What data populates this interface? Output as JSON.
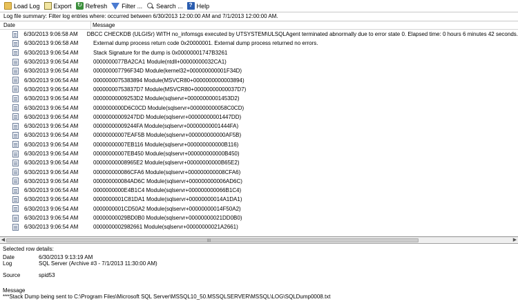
{
  "toolbar": {
    "load_log": "Load Log",
    "export": "Export",
    "refresh": "Refresh",
    "filter": "Filter ...",
    "search": "Search ...",
    "help": "Help"
  },
  "summary": "Log file summary: Filter log entries where: occurred between 6/30/2013 12:00:00 AM and 7/1/2013 12:00:00 AM.",
  "columns": {
    "date": "Date",
    "message": "Message"
  },
  "rows": [
    {
      "date": "6/30/2013 9:06:58 AM",
      "message": "DBCC CHECKDB (ULGISr) WITH no_infomsgs executed by UTSYSTEM\\ULSQLAgent terminated abnormally due to error state 0. Elapsed time: 0 hours 6 minutes 42 seconds."
    },
    {
      "date": "6/30/2013 9:06:58 AM",
      "message": "External dump process return code 0x20000001.  External dump process returned no errors."
    },
    {
      "date": "6/30/2013 9:06:54 AM",
      "message": "Stack Signature for the dump is 0x00000001747B3261"
    },
    {
      "date": "6/30/2013 9:06:54 AM",
      "message": "0000000077BA2CA1 Module(ntdll+00000000032CA1)"
    },
    {
      "date": "6/30/2013 9:06:54 AM",
      "message": "000000007796F34D Module(kernel32+000000000001F34D)"
    },
    {
      "date": "6/30/2013 9:06:54 AM",
      "message": "0000000075383894 Module(MSVCR80+0000000000003894)"
    },
    {
      "date": "6/30/2013 9:06:54 AM",
      "message": "00000000753837D7 Module(MSVCR80+00000000000037D7)"
    },
    {
      "date": "6/30/2013 9:06:54 AM",
      "message": "00000000009253D2 Module(sqlservr+00000000001453D2)"
    },
    {
      "date": "6/30/2013 9:06:54 AM",
      "message": "0000000000D6C0CD Module(sqlservr+000000000058C0CD)"
    },
    {
      "date": "6/30/2013 9:06:54 AM",
      "message": "00000000009247DD Module(sqlservr+00000000001447DD)"
    },
    {
      "date": "6/30/2013 9:06:54 AM",
      "message": "00000000009244FA Module(sqlservr+00000000001444FA)"
    },
    {
      "date": "6/30/2013 9:06:54 AM",
      "message": "00000000007EAF5B Module(sqlservr+000000000000AF5B)"
    },
    {
      "date": "6/30/2013 9:06:54 AM",
      "message": "00000000007EB116 Module(sqlservr+000000000000B116)"
    },
    {
      "date": "6/30/2013 9:06:54 AM",
      "message": "00000000007EB450 Module(sqlservr+000000000000B450)"
    },
    {
      "date": "6/30/2013 9:06:54 AM",
      "message": "00000000008965E2 Module(sqlservr+00000000000B65E2)"
    },
    {
      "date": "6/30/2013 9:06:54 AM",
      "message": "000000000086CFA6 Module(sqlservr+000000000008CFA6)"
    },
    {
      "date": "6/30/2013 9:06:54 AM",
      "message": "000000000084AD6C Module(sqlservr+000000000006AD6C)"
    },
    {
      "date": "6/30/2013 9:06:54 AM",
      "message": "0000000000E4B1C4 Module(sqlservr+000000000066B1C4)"
    },
    {
      "date": "6/30/2013 9:06:54 AM",
      "message": "0000000001C81DA1 Module(sqlservr+00000000014A1DA1)"
    },
    {
      "date": "6/30/2013 9:06:54 AM",
      "message": "0000000001CD50A2 Module(sqlservr+00000000014F50A2)"
    },
    {
      "date": "6/30/2013 9:06:54 AM",
      "message": "00000000029BD0B0 Module(sqlservr+00000000021DD0B0)"
    },
    {
      "date": "6/30/2013 9:06:54 AM",
      "message": "0000000002982661 Module(sqlservr+00000000021A2661)"
    }
  ],
  "details": {
    "heading": "Selected row details:",
    "date_label": "Date",
    "date_value": "6/30/2013 9:13:19 AM",
    "log_label": "Log",
    "log_value": "SQL Server (Archive #3 - 7/1/2013 11:30:00 AM)",
    "source_label": "Source",
    "source_value": "spid53",
    "message_label": "Message",
    "message_value": "***Stack Dump being sent to C:\\Program Files\\Microsoft SQL Server\\MSSQL10_50.MSSQLSERVER\\MSSQL\\LOG\\SQLDump0008.txt"
  },
  "scrollbar_grip": "III"
}
